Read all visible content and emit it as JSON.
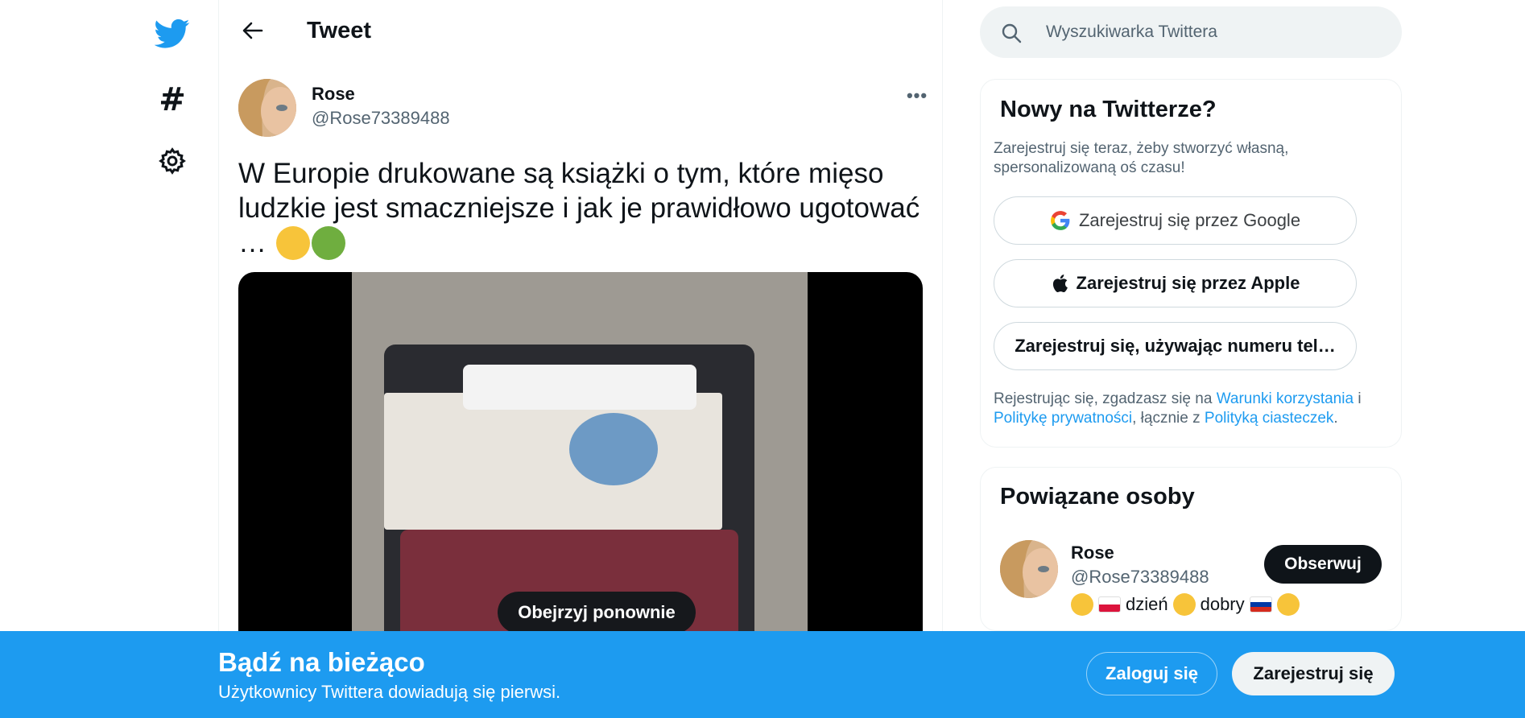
{
  "nav": {
    "icons": [
      "twitter-bird-icon",
      "hashtag-icon",
      "gear-icon"
    ],
    "brand_color": "#1d9bf0"
  },
  "header": {
    "title": "Tweet"
  },
  "tweet": {
    "author_name": "Rose",
    "author_handle": "@Rose73389488",
    "text": "W Europie drukowane są książki o tym, które mięso ludzkie jest smaczniejsze i jak je prawidłowo ugotować …",
    "media": {
      "replay_label": "Obejrzyj ponownie"
    }
  },
  "search": {
    "placeholder": "Wyszukiwarka Twittera"
  },
  "signup_card": {
    "title": "Nowy na Twitterze?",
    "description": "Zarejestruj się teraz, żeby stworzyć własną, spersonalizowaną oś czasu!",
    "google_label": "Zarejestruj się przez Google",
    "apple_label": "Zarejestruj się przez Apple",
    "phone_label": "Zarejestruj się, używając numeru tel…",
    "terms_prefix": "Rejestrując się, zgadzasz się na ",
    "terms_link": "Warunki korzystania",
    "terms_and": " i ",
    "privacy_link": "Politykę prywatności",
    "terms_mid": ", łącznie z ",
    "cookies_link": "Polityką ciasteczek",
    "terms_end": "."
  },
  "related_card": {
    "title": "Powiązane osoby",
    "name": "Rose",
    "handle": "@Rose73389488",
    "bio_word1": "dzień",
    "bio_word2": "dobry",
    "follow_label": "Obserwuj"
  },
  "banner": {
    "title": "Bądź na bieżąco",
    "subtitle": "Użytkownicy Twittera dowiadują się pierwsi.",
    "login_label": "Zaloguj się",
    "register_label": "Zarejestruj się",
    "background": "#1d9bf0"
  }
}
